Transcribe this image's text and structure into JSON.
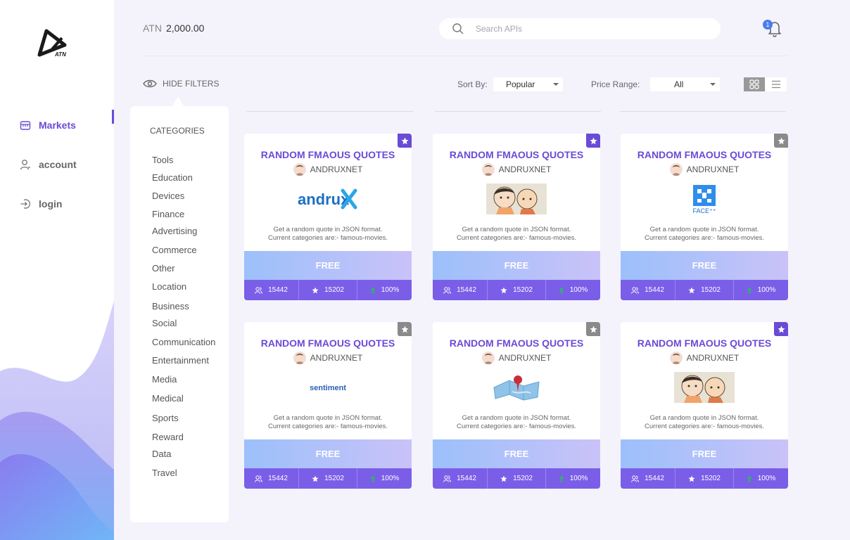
{
  "sidebar": {
    "logo_text": "ATN",
    "items": [
      {
        "label": "Markets",
        "icon": "store-icon",
        "active": true
      },
      {
        "label": "account",
        "icon": "user-icon",
        "active": false
      },
      {
        "label": "login",
        "icon": "login-icon",
        "active": false
      }
    ]
  },
  "header": {
    "balance_currency": "ATN",
    "balance_value": "2,000.00",
    "search_placeholder": "Search APIs",
    "notification_count": "1"
  },
  "filters": {
    "hide_label": "HIDE FILTERS",
    "sort_label": "Sort By:",
    "sort_value": "Popular",
    "price_label": "Price Range:",
    "price_value": "All"
  },
  "categories": {
    "title": "CATEGORIES",
    "items": [
      "Tools",
      "Education",
      "Devices",
      "Finance",
      "Advertising",
      "Commerce",
      "Other",
      "Location",
      "Business",
      "Social",
      "Communication",
      "Entertainment",
      "Media",
      "Medical",
      "Sports",
      "Reward",
      "Data",
      "Travel"
    ]
  },
  "cards": [
    {
      "title": "RANDOM FMAOUS QUOTES",
      "author": "ANDRUXNET",
      "logo": "andrux-logo",
      "logo_text": "andrux",
      "desc1": "Get a random quote in JSON format.",
      "desc2": "Current categories are:- famous-movies.",
      "price": "FREE",
      "users": "15442",
      "stars": "15202",
      "uptime": "100%",
      "favorite": true
    },
    {
      "title": "RANDOM FMAOUS QUOTES",
      "author": "ANDRUXNET",
      "logo": "cartoon-couple-image",
      "logo_text": "",
      "desc1": "Get a random quote in JSON format.",
      "desc2": "Current categories are:- famous-movies.",
      "price": "FREE",
      "users": "15442",
      "stars": "15202",
      "uptime": "100%",
      "favorite": true
    },
    {
      "title": "RANDOM FMAOUS QUOTES",
      "author": "ANDRUXNET",
      "logo": "faceplusplus-logo",
      "logo_text": "FACE⁺⁺",
      "desc1": "Get a random quote in JSON format.",
      "desc2": "Current categories are:- famous-movies.",
      "price": "FREE",
      "users": "15442",
      "stars": "15202",
      "uptime": "100%",
      "favorite": false
    },
    {
      "title": "RANDOM FMAOUS QUOTES",
      "author": "ANDRUXNET",
      "logo": "sentiment-logo",
      "logo_text": "sentiment",
      "desc1": "Get a random quote in JSON format.",
      "desc2": "Current categories are:- famous-movies.",
      "price": "FREE",
      "users": "15442",
      "stars": "15202",
      "uptime": "100%",
      "favorite": false
    },
    {
      "title": "RANDOM FMAOUS QUOTES",
      "author": "ANDRUXNET",
      "logo": "map-pin-image",
      "logo_text": "",
      "desc1": "Get a random quote in JSON format.",
      "desc2": "Current categories are:- famous-movies.",
      "price": "FREE",
      "users": "15442",
      "stars": "15202",
      "uptime": "100%",
      "favorite": false
    },
    {
      "title": "RANDOM FMAOUS QUOTES",
      "author": "ANDRUXNET",
      "logo": "cartoon-couple-image",
      "logo_text": "",
      "desc1": "Get a random quote in JSON format.",
      "desc2": "Current categories are:- famous-movies.",
      "price": "FREE",
      "users": "15442",
      "stars": "15202",
      "uptime": "100%",
      "favorite": true
    }
  ],
  "colors": {
    "accent": "#6a4bd6",
    "stats_bar": "#7b5ee8",
    "uptime_icon": "#2fb36b",
    "badge": "#4a7bf0"
  }
}
